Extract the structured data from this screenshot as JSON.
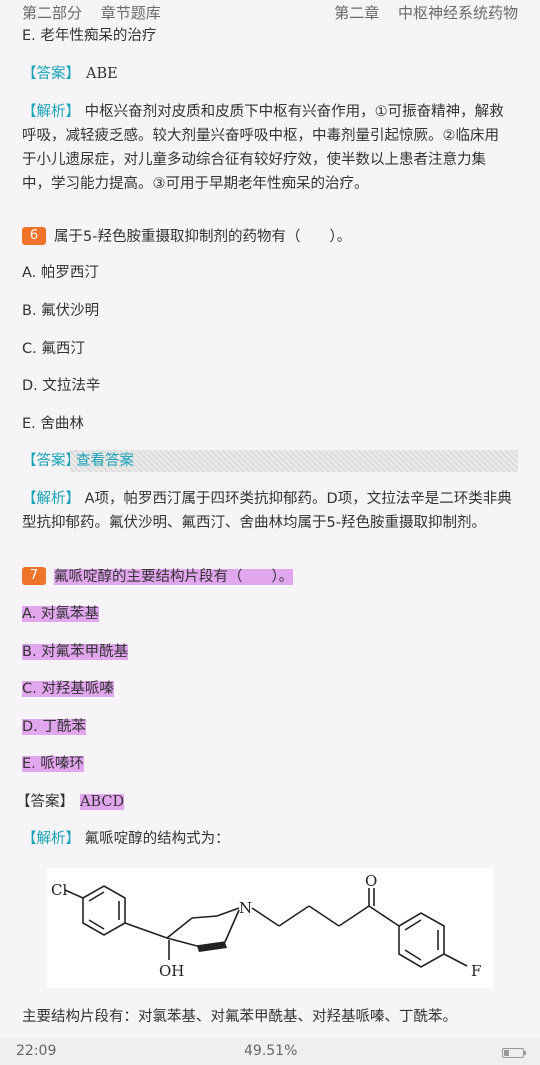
{
  "header": {
    "part": "第二部分",
    "section": "章节题库",
    "chapter": "第二章",
    "chapter_title": "中枢神经系统药物"
  },
  "q5": {
    "option_e": "E. 老年性痴呆的治疗",
    "answer_tag": "【答案】",
    "answer": "ABE",
    "analysis_tag": "【解析】",
    "analysis_lines": [
      "中枢兴奋剂对皮质和皮质下中枢有兴奋作用，①可振奋精神，解救",
      "呼吸，减轻疲乏感。较大剂量兴奋呼吸中枢，中毒剂量引起惊厥。②临床用",
      "于小儿遗尿症，对儿童多动综合征有较好疗效，使半数以上患者注意力集",
      "中，学习能力提高。③可用于早期老年性痴呆的治疗。"
    ]
  },
  "q6": {
    "number": "6",
    "question": "属于5-羟色胺重摄取抑制剂的药物有（　　）。",
    "options": [
      "A. 帕罗西汀",
      "B. 氟伏沙明",
      "C. 氟西汀",
      "D. 文拉法辛",
      "E. 舍曲林"
    ],
    "answer_tag": "【答案】",
    "view_answer": "查看答案",
    "analysis_tag": "【解析】",
    "analysis_lines": [
      "A项，帕罗西汀属于四环类抗抑郁药。D项，文拉法辛是二环类非典",
      "型抗抑郁药。氟伏沙明、氟西汀、舍曲林均属于5-羟色胺重摄取抑制剂。"
    ]
  },
  "q7": {
    "number": "7",
    "question": "氟哌啶醇的主要结构片段有（　　）。",
    "options": [
      "A. 对氯苯基",
      "B. 对氟苯甲酰基",
      "C. 对羟基哌嗪",
      "D. 丁酰苯",
      "E. 哌嗪环"
    ],
    "answer_tag": "【答案】",
    "answer": "ABCD",
    "analysis_tag": "【解析】",
    "analysis_text": "氟哌啶醇的结构式为：",
    "structure_labels": {
      "cl": "Cl",
      "n": "N",
      "o": "O",
      "oh": "OH",
      "f": "F"
    },
    "summary": "主要结构片段有：对氯苯基、对氟苯甲酰基、对羟基哌嗪、丁酰苯。"
  },
  "footer": {
    "time": "22:09",
    "progress_text": "49.51%",
    "battery_level": 0.3
  }
}
